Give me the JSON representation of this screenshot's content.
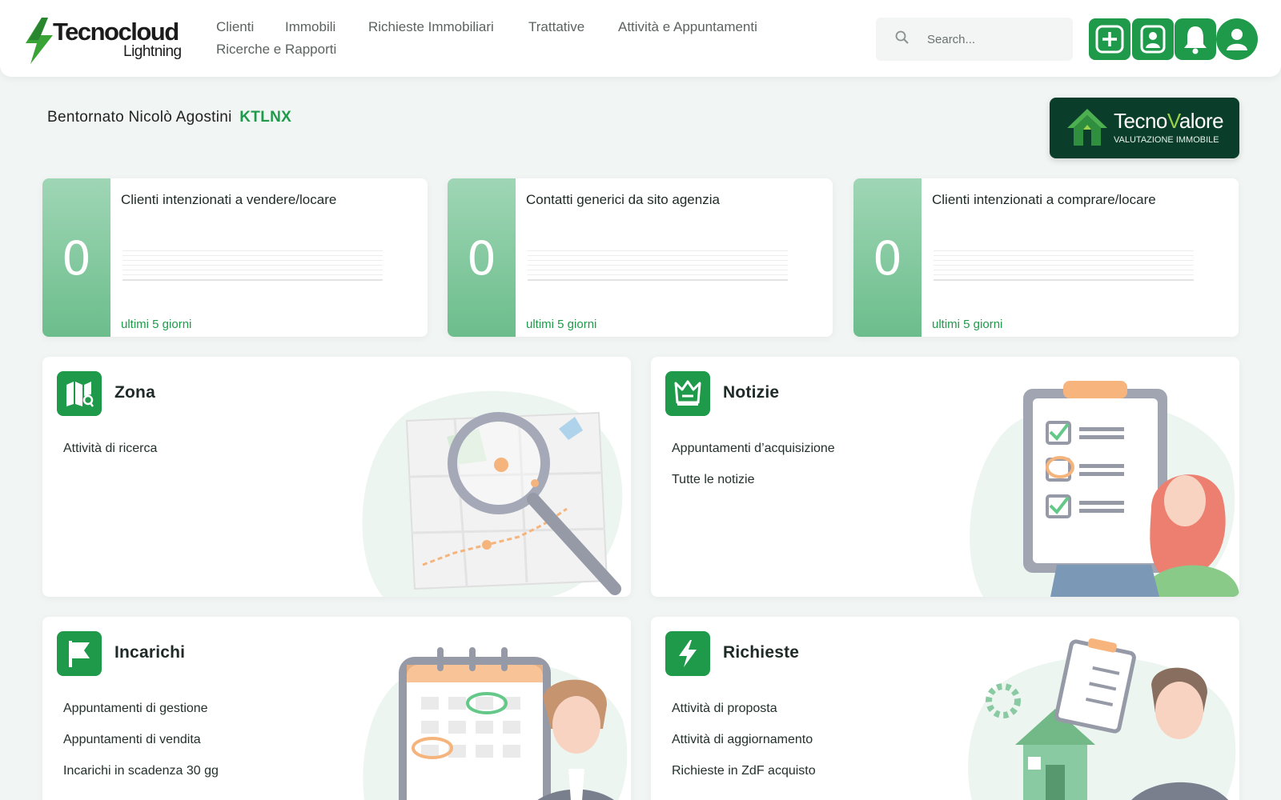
{
  "app": {
    "logo_title": "Tecnocloud",
    "logo_subtitle": "Lightning",
    "brand_color": "#1f9a4a"
  },
  "nav": {
    "items": [
      {
        "label": "Clienti"
      },
      {
        "label": "Immobili"
      },
      {
        "label": "Richieste Immobiliari"
      },
      {
        "label": "Trattative"
      },
      {
        "label": "Attività e Appuntamenti"
      },
      {
        "label": "Ricerche e Rapporti"
      }
    ]
  },
  "search": {
    "placeholder": "Search...",
    "icon": "search-icon"
  },
  "header_buttons": [
    {
      "icon": "plus-icon"
    },
    {
      "icon": "contact-card-icon"
    },
    {
      "icon": "bell-icon"
    },
    {
      "icon": "user-icon"
    }
  ],
  "welcome": {
    "text": "Bentornato Nicolò Agostini",
    "code": "KTLNX"
  },
  "banner": {
    "title_a": "Tecno",
    "title_b": "V",
    "title_c": "alore",
    "subtitle": "VALUTAZIONE IMMOBILE"
  },
  "stats": [
    {
      "value": "0",
      "title": "Clienti intenzionati a vendere/locare",
      "period": "ultimi 5 giorni"
    },
    {
      "value": "0",
      "title": "Contatti generici da sito agenzia",
      "period": "ultimi 5 giorni"
    },
    {
      "value": "0",
      "title": "Clienti intenzionati a comprare/locare",
      "period": "ultimi 5 giorni"
    }
  ],
  "sections": {
    "zona": {
      "title": "Zona",
      "icon": "map-icon",
      "items": [
        "Attività di ricerca"
      ]
    },
    "notizie": {
      "title": "Notizie",
      "icon": "crown-icon",
      "items": [
        "Appuntamenti d’acquisizione",
        "Tutte le notizie"
      ]
    },
    "incarichi": {
      "title": "Incarichi",
      "icon": "flag-icon",
      "items": [
        "Appuntamenti di gestione",
        "Appuntamenti di vendita",
        "Incarichi in scadenza 30 gg"
      ]
    },
    "richieste": {
      "title": "Richieste",
      "icon": "lightning-icon",
      "items": [
        "Attività di proposta",
        "Attività di aggiornamento",
        "Richieste in ZdF acquisto"
      ]
    }
  }
}
